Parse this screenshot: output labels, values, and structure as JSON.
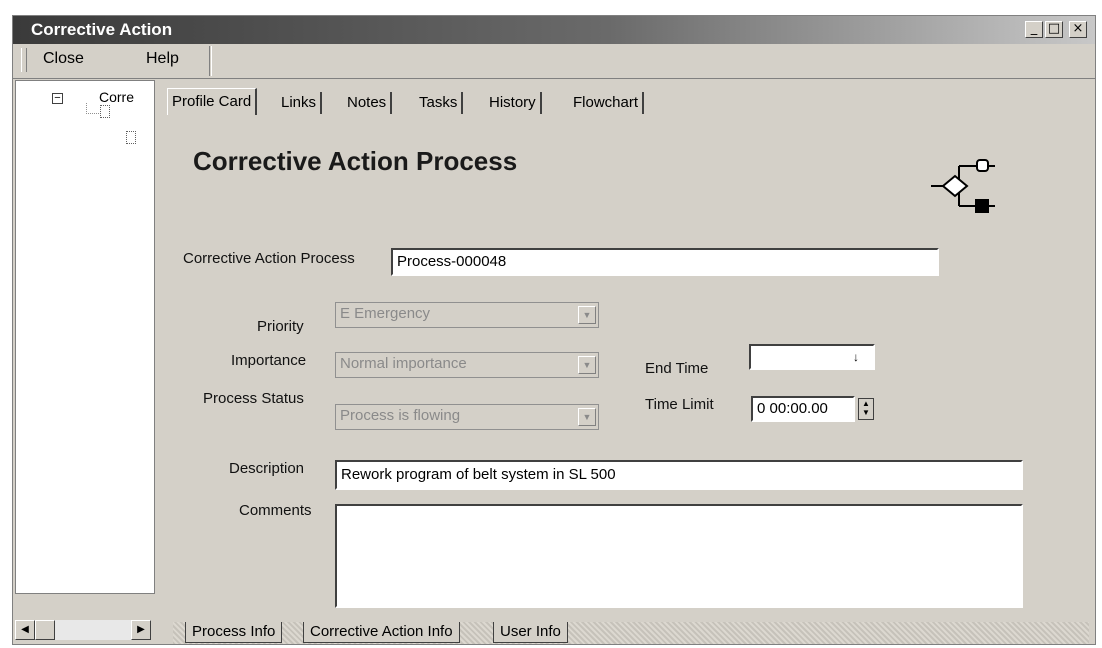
{
  "window": {
    "title": "Corrective Action",
    "controls": {
      "minimize": "_",
      "maximize": "□",
      "close": "×"
    }
  },
  "menu": {
    "close": "Close",
    "help": "Help"
  },
  "tree": {
    "root_label": "Corre"
  },
  "tabs": [
    "Profile Card",
    "Links",
    "Notes",
    "Tasks",
    "History",
    "Flowchart"
  ],
  "active_tab": "Profile Card",
  "form": {
    "heading": "Corrective Action Process",
    "process_label": "Corrective Action Process",
    "process_value": "Process-000048",
    "priority_label": "Priority",
    "priority_value": "E Emergency",
    "importance_label": "Importance",
    "importance_value": "Normal importance",
    "status_label": "Process Status",
    "status_value": "Process is flowing",
    "end_time_label": "End Time",
    "end_time_value": "",
    "time_limit_label": "Time Limit",
    "time_limit_value": "0 00:00.00",
    "description_label": "Description",
    "description_value": "Rework program of belt system in SL 500",
    "comments_label": "Comments",
    "comments_value": ""
  },
  "bottom_tabs": [
    "Process Info",
    "Corrective Action Info",
    "User Info"
  ],
  "icons": {
    "flowchart": "flowchart-icon",
    "tree_expander": "minus-box-icon",
    "scroll_left": "arrow-left-icon",
    "scroll_right": "arrow-right-icon"
  }
}
